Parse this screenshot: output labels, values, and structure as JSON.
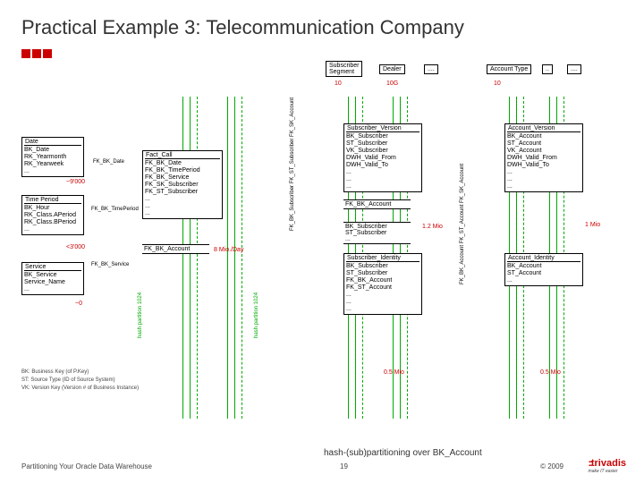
{
  "title": "Practical Example 3: Telecommunication Company",
  "topEntities": {
    "subscriberSegment": {
      "label": "Subscriber\nSegment",
      "count": "10"
    },
    "dealer": {
      "label": "Dealer",
      "count": "10G"
    },
    "dots1": "....",
    "accountType": {
      "label": "Account Type",
      "count": "10"
    },
    "dots2": "..",
    "dots3": "...."
  },
  "date": {
    "label": "Date",
    "fields": "BK_Date\nRK_Yearmonth\nRK_Yearweek\n...",
    "count": "~9'000",
    "rel": "FK_BK_Date"
  },
  "timePeriod": {
    "label": "Time Period",
    "fields": "BK_Hour\nRK_Class.APeriod\nRK_Class.BPeriod\n...",
    "count": "<3'000",
    "rel": "FK_BK_TimePeriod"
  },
  "service": {
    "label": "Service",
    "fields": "BK_Service\nService_Name\n...",
    "count": "~0",
    "rel": "FK_BK_Service"
  },
  "factCall": {
    "label": "Fact_Call",
    "fields": "FK_BK_Date\nFK_BK_TimePeriod\nFK_BK_Service\nFK_SK_Subscriber\nFK_ST_Subscriber\n...\n...\n...",
    "fkAccount": "FK_BK_Account",
    "count": "8 Mio./Day",
    "rotated": "hash partition 1024",
    "fkRotated": "FK_BK_Subscriber\nFK_ST_Subscriber\nFK_SK_Account"
  },
  "subscriberVersion": {
    "label": "Subscriber_Version",
    "fields": "BK_Subscriber\nST_Subscriber\nVK_Subscriber\nDWH_Valid_From\nDWH_Valid_To\n...\n...\n...",
    "fkAccount": "FK_BK_Account"
  },
  "subscriberIdentity": {
    "label": "Subscriber_Identity",
    "topFields": "BK_Subscriber\nST_Subscriber\n...",
    "fields": "BK_Subscriber\nST_Subscriber\nFK_BK_Account\nFK_ST_Account\n...\n...\n...",
    "count": "0.5 Mio",
    "count2": "1.2 Mio"
  },
  "accountVersion": {
    "label": "Account_Version",
    "fields": "BK_Account\nST_Account\nVK_Account\nDWH_Valid_From\nDWH_Valid_To\n...\n...\n...",
    "fkRotated": "FK_BK_Account\nFK_ST_Account\nFK_SK_Account"
  },
  "accountIdentity": {
    "label": "Account_Identity",
    "fields": "BK_Account\nST_Account\n...",
    "count": "0.5 Mio",
    "count2": "1 Mio"
  },
  "legend": {
    "bk": "BK: Business Key (of P.Key)",
    "st": "ST: Source Type (ID of Source System)",
    "vk": "VK: Version Key (Version # of Business Instance)"
  },
  "footer": {
    "left": "Partitioning Your Oracle Data Warehouse",
    "caption": "hash-(sub)partitioning over BK_Account",
    "page": "19",
    "copy": "© 2009"
  },
  "logo": {
    "name": "trivadis",
    "tag": "make IT easier"
  }
}
